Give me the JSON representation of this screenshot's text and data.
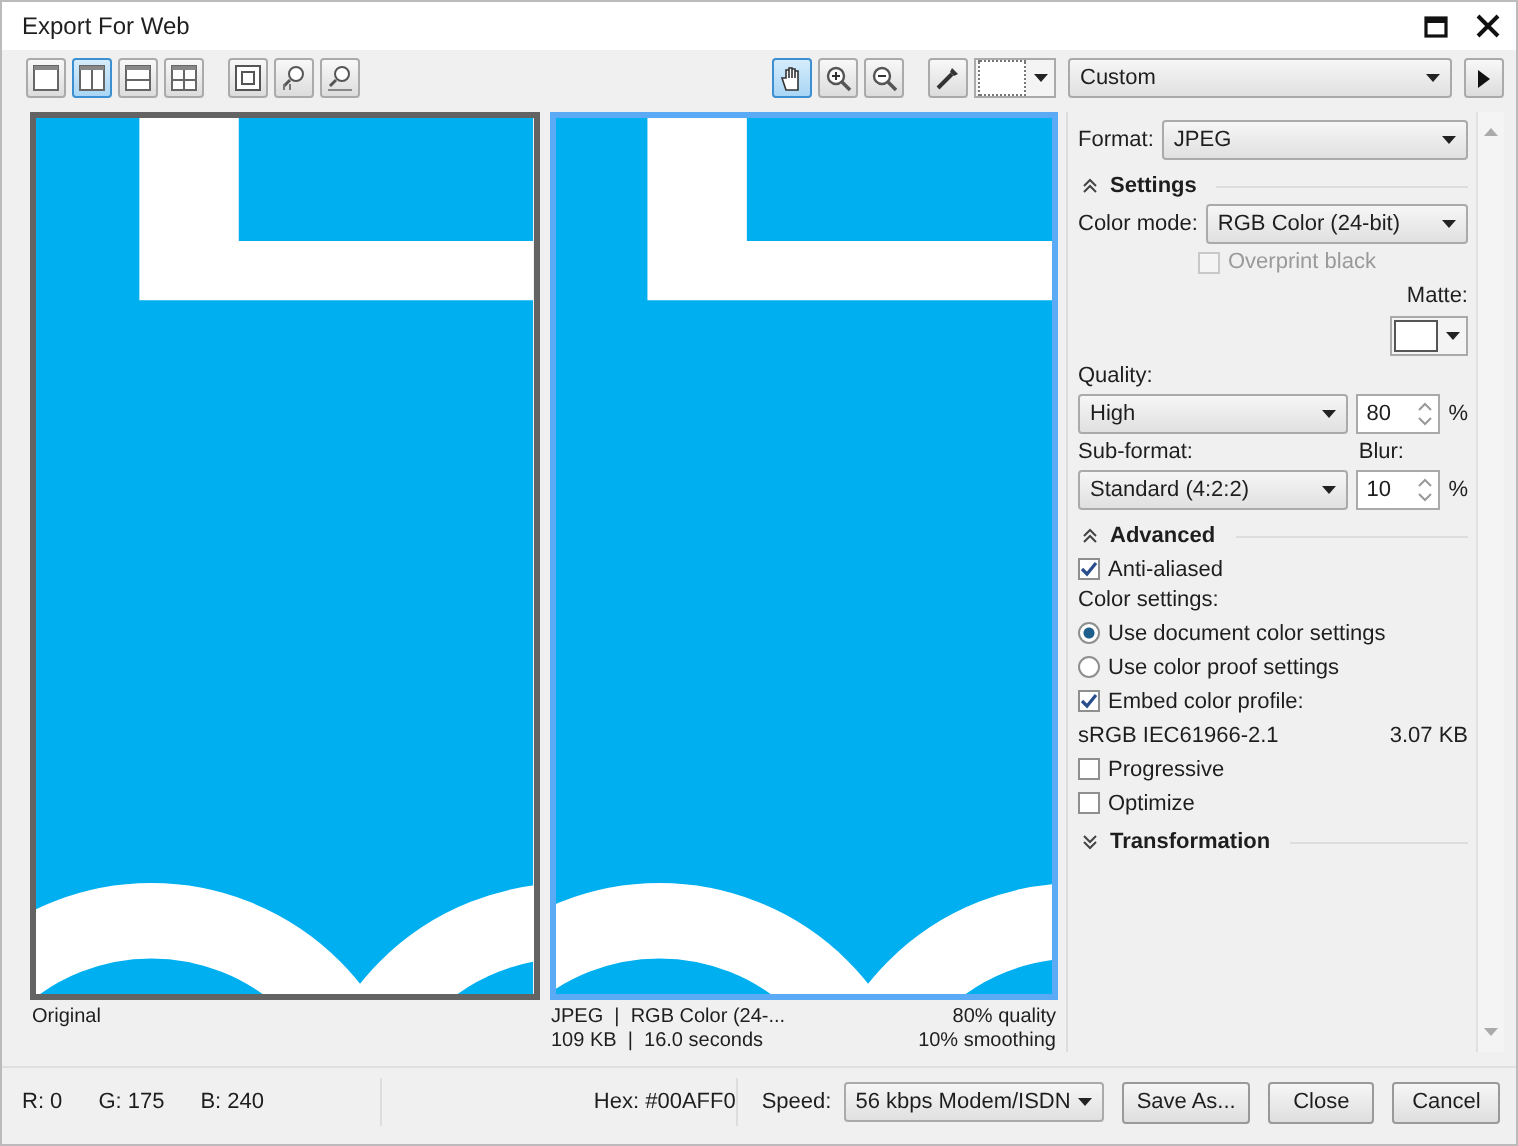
{
  "window": {
    "title": "Export For Web"
  },
  "view_modes": [
    {
      "selected": false
    },
    {
      "selected": true
    },
    {
      "selected": false
    },
    {
      "selected": false
    }
  ],
  "tools": [
    {
      "selected": true
    },
    {
      "selected": false
    },
    {
      "selected": false
    }
  ],
  "preset": {
    "value": "Custom"
  },
  "previews": [
    {
      "selected": false,
      "caption_left": [
        "Original"
      ]
    },
    {
      "selected": true,
      "caption_left": [
        "JPEG  |  RGB Color (24-...",
        "109 KB  |  16.0 seconds"
      ],
      "caption_right": [
        "80% quality",
        "10% smoothing"
      ]
    }
  ],
  "format": {
    "label": "Format:",
    "value": "JPEG"
  },
  "settings": {
    "title": "Settings",
    "expanded": true,
    "color_mode_label": "Color mode:",
    "color_mode": "RGB Color (24-bit)",
    "overprint": {
      "label": "Overprint black",
      "checked": false,
      "disabled": true
    },
    "matte_label": "Matte:",
    "quality_label": "Quality:",
    "quality": "High",
    "quality_value": "80",
    "quality_unit": "%",
    "subformat_label": "Sub-format:",
    "subformat": "Standard (4:2:2)",
    "blur_label": "Blur:",
    "blur_value": "10",
    "blur_unit": "%"
  },
  "advanced": {
    "title": "Advanced",
    "expanded": true,
    "anti_aliased": {
      "label": "Anti-aliased",
      "checked": true
    },
    "color_settings_label": "Color settings:",
    "color_options": [
      {
        "label": "Use document color settings",
        "selected": true
      },
      {
        "label": "Use color proof settings",
        "selected": false
      }
    ],
    "embed": {
      "label": "Embed color profile:",
      "checked": true
    },
    "profile": "sRGB IEC61966-2.1",
    "profile_size": "3.07 KB",
    "options": [
      {
        "label": "Progressive",
        "checked": false
      },
      {
        "label": "Optimize",
        "checked": false
      }
    ]
  },
  "transformation": {
    "title": "Transformation",
    "expanded": false
  },
  "status": {
    "readouts": [
      "R: 0",
      "G: 175",
      "B: 240"
    ],
    "hex": "Hex: #00AFF0",
    "speed_label": "Speed:",
    "speed": "56 kbps Modem/ISDN"
  },
  "buttons": [
    "Save As...",
    "Close",
    "Cancel"
  ]
}
